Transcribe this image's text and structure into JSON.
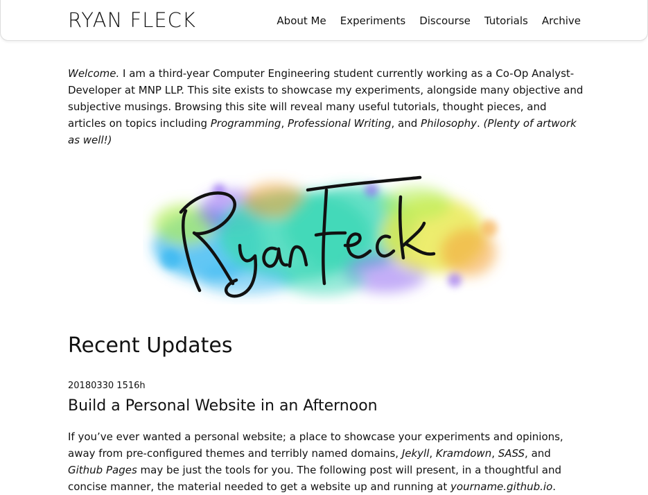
{
  "header": {
    "site_title": "RYAN FLECK",
    "nav": [
      "About Me",
      "Experiments",
      "Discourse",
      "Tutorials",
      "Archive"
    ]
  },
  "intro": {
    "welcome": "Welcome.",
    "text_1": " I am a third-year Computer Engineering student currently working as a Co-Op Analyst-Developer at MNP LLP. This site exists to showcase my experiments, alongside many objective and subjective musings. Browsing this site will reveal many useful tutorials, thought pieces, and articles on topics including ",
    "topic_1": "Programming",
    "sep_1": ", ",
    "topic_2": "Professional Writing",
    "sep_2": ", and ",
    "topic_3": "Philosophy",
    "sep_3": ". ",
    "aside": "(Plenty of artwork as well!)"
  },
  "banner": {
    "signature": "Ryan Fleck",
    "colors": [
      "#3fd8b8",
      "#2fb4f0",
      "#8a5cf0",
      "#f5a640",
      "#e9e84a",
      "#b6f05a"
    ]
  },
  "recent": {
    "heading": "Recent Updates",
    "posts": [
      {
        "date": "20180330 1516h",
        "title": "Build a Personal Website in an Afternoon",
        "excerpt_1": "If you’ve ever wanted a personal website; a place to showcase your experiments and opinions, away from pre-configured themes and terribly named domains, ",
        "tool_1": "Jekyll",
        "sep_1": ", ",
        "tool_2": "Kramdown",
        "sep_2": ", ",
        "tool_3": "SASS",
        "sep_3": ", and ",
        "tool_4": "Github Pages",
        "excerpt_2": " may be just the tools for you. The following post will present, in a thoughtful and concise manner, the material needed to get a website up and running at ",
        "domain": "yourname.github.io",
        "excerpt_3": "."
      }
    ]
  }
}
